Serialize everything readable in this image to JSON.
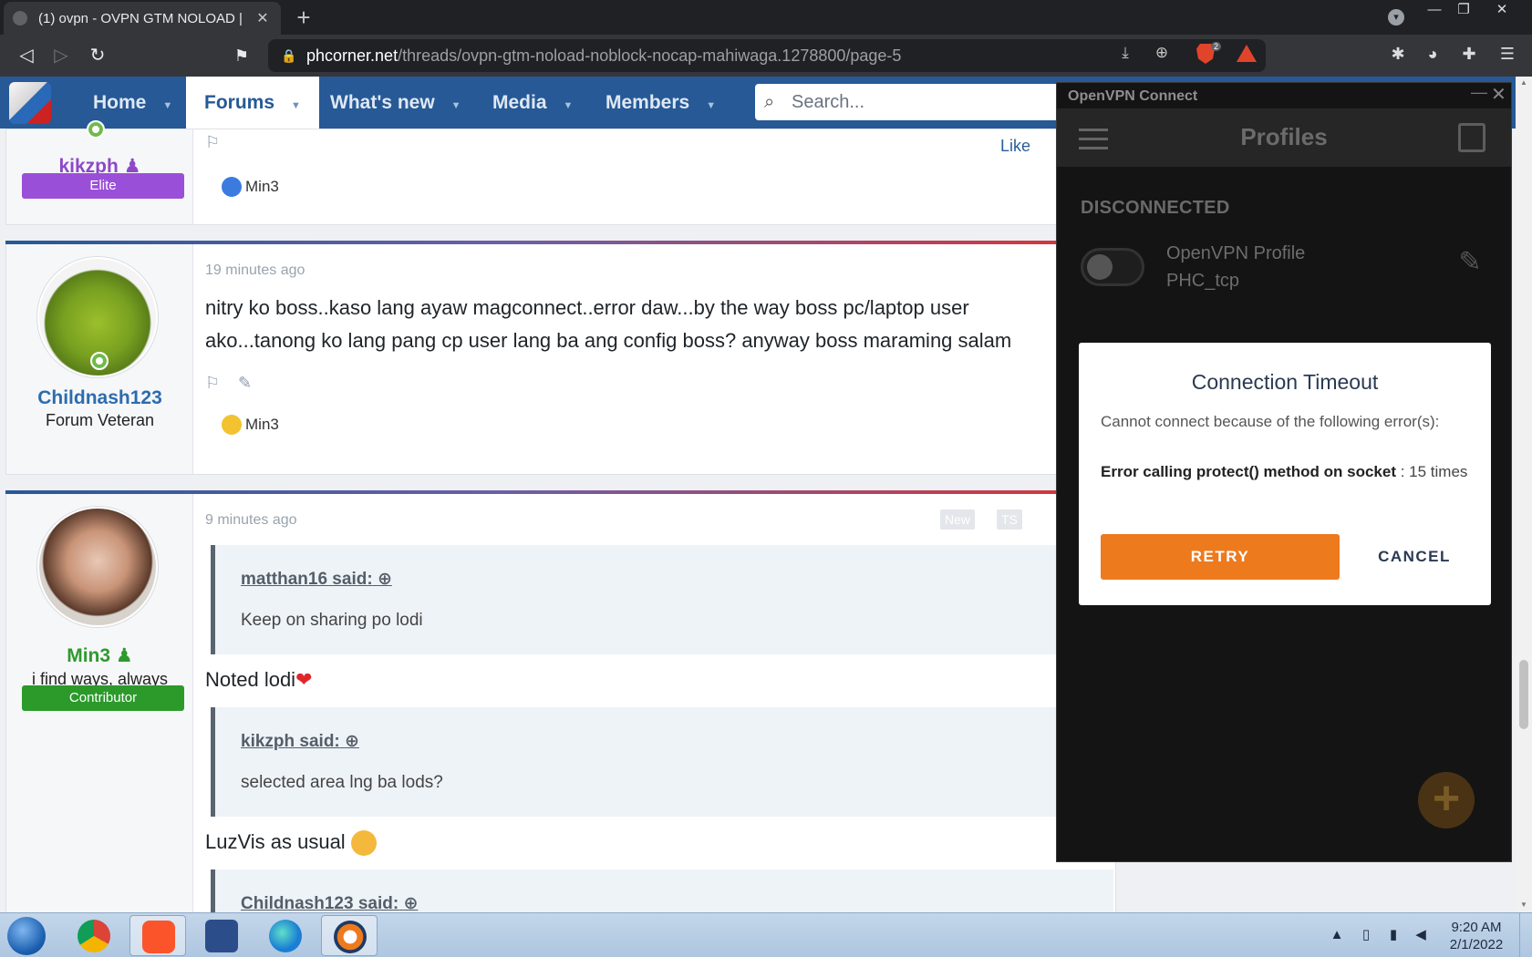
{
  "browser": {
    "tab_title": "(1) ovpn - OVPN GTM NOLOAD |",
    "tab_close": "✕",
    "new_tab": "+",
    "url_host": "phcorner.net",
    "url_path": "/threads/ovpn-gtm-noload-noblock-nocap-mahiwaga.1278800/page-5",
    "brave_count": "2"
  },
  "forum": {
    "nav": {
      "home": "Home",
      "forums": "Forums",
      "whats_new": "What's new",
      "media": "Media",
      "members": "Members"
    },
    "search_placeholder": "Search...",
    "posts": [
      {
        "username": "kikzph",
        "badge": "Elite",
        "like_label": "Like",
        "reaction_user": "Min3"
      },
      {
        "username": "Childnash123",
        "user_title": "Forum Veteran",
        "time": "19 minutes ago",
        "line1": "nitry ko boss..kaso lang ayaw magconnect..error daw...by the way boss pc/laptop user",
        "line2": "ako...tanong ko lang pang cp user lang ba ang config boss? anyway boss maraming salam",
        "reaction_user": "Min3"
      },
      {
        "username": "Min3",
        "user_title": "i find ways, always",
        "badge": "Contributor",
        "time": "9 minutes ago",
        "tag_new": "New",
        "tag_ts": "TS",
        "quote1_author": "matthan16 said:",
        "quote1_text": "Keep on sharing po lodi",
        "reply1": "Noted lodi",
        "quote2_author": "kikzph said:",
        "quote2_text": "selected area lng ba lods?",
        "reply2": "LuzVis as usual",
        "quote3_author": "Childnash123 said:"
      }
    ]
  },
  "openvpn": {
    "window_title": "OpenVPN Connect",
    "header_title": "Profiles",
    "status": "DISCONNECTED",
    "profile_name": "OpenVPN Profile",
    "profile_sub": "PHC_tcp",
    "dialog": {
      "title": "Connection Timeout",
      "message": "Cannot connect because of the following error(s):",
      "error_bold": "Error calling protect() method on socket",
      "error_rest": " : 15 times",
      "retry": "RETRY",
      "cancel": "CANCEL"
    },
    "accent_color": "#ee7a1e"
  },
  "taskbar": {
    "time": "9:20 AM",
    "date": "2/1/2022"
  }
}
